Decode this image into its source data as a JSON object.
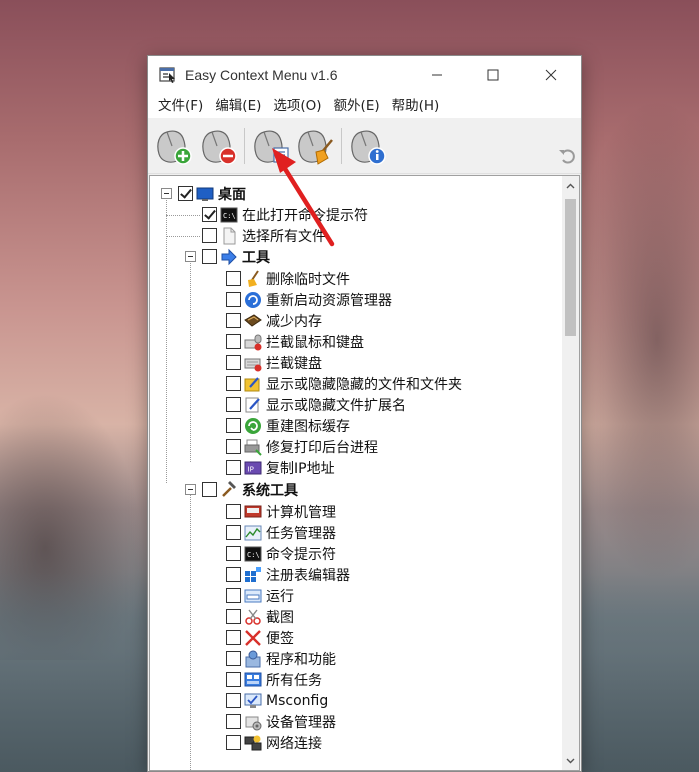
{
  "window": {
    "title": "Easy Context Menu v1.6",
    "controls": {
      "minimize": "minimize",
      "maximize": "maximize",
      "close": "close"
    }
  },
  "menu": [
    "文件(F)",
    "编辑(E)",
    "选项(O)",
    "额外(E)",
    "帮助(H)"
  ],
  "toolbar": {
    "buttons": [
      {
        "name": "add-menu",
        "icon": "mouse-add-icon"
      },
      {
        "name": "remove-menu",
        "icon": "mouse-remove-icon"
      },
      {
        "name": "edit-list",
        "icon": "mouse-list-icon"
      },
      {
        "name": "cleaner",
        "icon": "mouse-broom-icon"
      },
      {
        "name": "about",
        "icon": "mouse-info-icon"
      }
    ],
    "undo_icon": "undo-icon"
  },
  "tree": {
    "desktop": {
      "label": "桌面",
      "checked": true,
      "items": [
        {
          "label": "在此打开命令提示符",
          "checked": true,
          "icon": "cmd-icon"
        },
        {
          "label": "选择所有文件",
          "checked": false,
          "icon": "file-icon"
        }
      ]
    },
    "tools": {
      "label": "工具",
      "items": [
        {
          "label": "删除临时文件",
          "icon": "broom-icon"
        },
        {
          "label": "重新启动资源管理器",
          "icon": "restart-icon"
        },
        {
          "label": "减少内存",
          "icon": "memory-icon"
        },
        {
          "label": "拦截鼠标和键盘",
          "icon": "keyboard-mouse-icon"
        },
        {
          "label": "拦截键盘",
          "icon": "keyboard-icon"
        },
        {
          "label": "显示或隐藏隐藏的文件和文件夹",
          "icon": "hidden-files-icon"
        },
        {
          "label": "显示或隐藏文件扩展名",
          "icon": "extension-icon"
        },
        {
          "label": "重建图标缓存",
          "icon": "refresh-icon"
        },
        {
          "label": "修复打印后台进程",
          "icon": "printer-icon"
        },
        {
          "label": "复制IP地址",
          "icon": "ip-icon"
        }
      ]
    },
    "system_tools": {
      "label": "系统工具",
      "items": [
        {
          "label": "计算机管理",
          "icon": "computer-management-icon"
        },
        {
          "label": "任务管理器",
          "icon": "task-manager-icon"
        },
        {
          "label": "命令提示符",
          "icon": "cmd-icon"
        },
        {
          "label": "注册表编辑器",
          "icon": "registry-icon"
        },
        {
          "label": "运行",
          "icon": "run-icon"
        },
        {
          "label": "截图",
          "icon": "snipping-icon"
        },
        {
          "label": "便签",
          "icon": "sticky-note-icon"
        },
        {
          "label": "程序和功能",
          "icon": "programs-icon"
        },
        {
          "label": "所有任务",
          "icon": "all-tasks-icon"
        },
        {
          "label": "Msconfig",
          "icon": "msconfig-icon"
        },
        {
          "label": "设备管理器",
          "icon": "device-manager-icon"
        },
        {
          "label": "网络连接",
          "icon": "network-icon"
        }
      ]
    }
  },
  "colors": {
    "window_bg": "#f0f0f0",
    "tree_bg": "#ffffff",
    "annotation_arrow": "#e02020"
  }
}
